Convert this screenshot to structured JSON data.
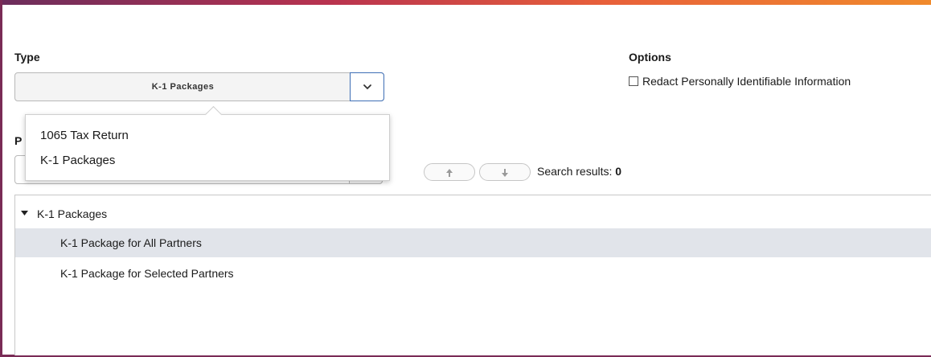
{
  "type_section": {
    "label": "Type",
    "selected_value": "K-1 Packages",
    "dropdown_options": [
      "1065 Tax Return",
      "K-1 Packages"
    ]
  },
  "options_section": {
    "label": "Options",
    "redact_label": "Redact Personally Identifiable Information",
    "redact_checked": false
  },
  "partial_label": "P",
  "search": {
    "results_label": "Search results:",
    "results_count": "0"
  },
  "tree": {
    "root_label": "K-1 Packages",
    "children": [
      "K-1 Package for All Partners",
      "K-1 Package for Selected Partners"
    ],
    "selected_index": 0
  },
  "colors": {
    "accent_border": "#7a2b56",
    "selected_row": "#e1e4ea",
    "dropdown_btn_border": "#3f6fb5"
  }
}
